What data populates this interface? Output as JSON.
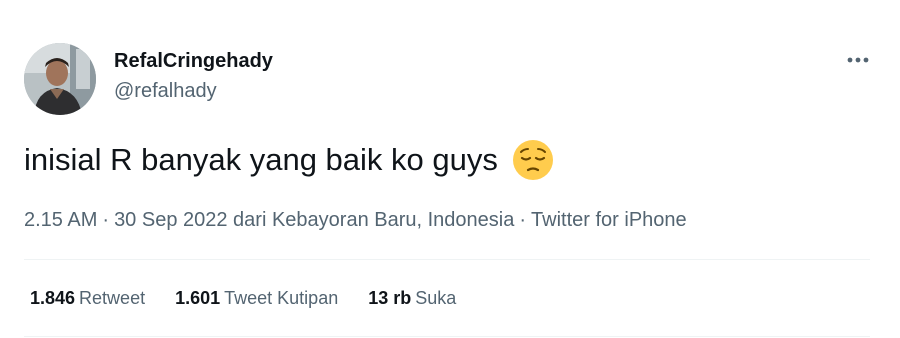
{
  "author": {
    "display_name": "RefalCringehady",
    "handle": "@refalhady",
    "avatar_icon": "profile-photo"
  },
  "tweet": {
    "text": "inisial R banyak yang baik ko guys",
    "emoji": "pensive-face",
    "time": "2.15 AM",
    "separator": "·",
    "date_location": "30 Sep 2022 dari Kebayoran Baru, Indonesia",
    "source": "Twitter for iPhone"
  },
  "stats": {
    "retweets": {
      "count": "1.846",
      "label": "Retweet"
    },
    "quotes": {
      "count": "1.601",
      "label": "Tweet Kutipan"
    },
    "likes": {
      "count": "13 rb",
      "label": "Suka"
    }
  },
  "colors": {
    "text_primary": "#0f1419",
    "text_secondary": "#536471",
    "divider": "#eff3f4"
  },
  "icons": {
    "more": "more-options-icon"
  }
}
